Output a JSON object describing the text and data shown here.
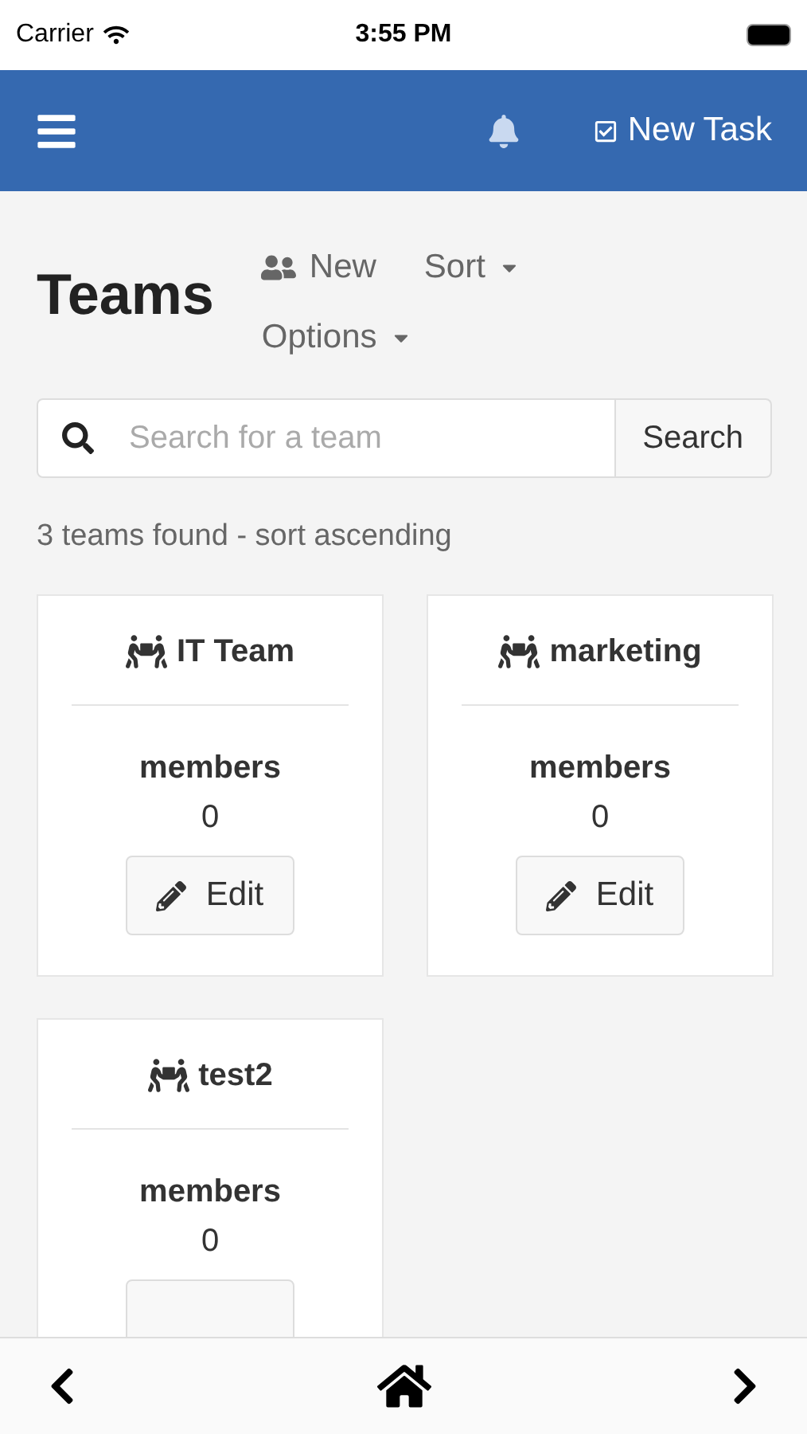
{
  "status_bar": {
    "carrier": "Carrier",
    "time": "3:55 PM"
  },
  "navbar": {
    "new_task": "New Task"
  },
  "header": {
    "title": "Teams",
    "new": "New",
    "sort": "Sort",
    "options": "Options"
  },
  "search": {
    "placeholder": "Search for a team",
    "button": "Search"
  },
  "summary": "3 teams found - sort ascending",
  "teams": [
    {
      "name": "IT Team",
      "members_label": "members",
      "members": "0",
      "edit": "Edit"
    },
    {
      "name": "marketing",
      "members_label": "members",
      "members": "0",
      "edit": "Edit"
    },
    {
      "name": "test2",
      "members_label": "members",
      "members": "0"
    }
  ]
}
